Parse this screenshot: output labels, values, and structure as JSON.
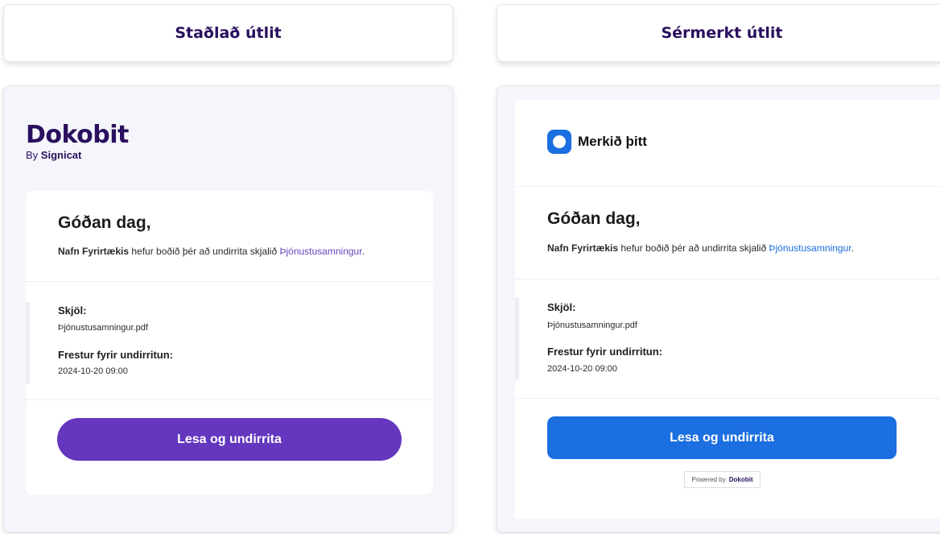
{
  "headers": {
    "standard": "Staðlað útlit",
    "branded": "Sérmerkt útlit"
  },
  "standard_email": {
    "logo": {
      "name": "Dokobit",
      "by": "By",
      "parent": "Signicat"
    },
    "greeting": "Góðan dag,",
    "invite": {
      "company": "Nafn Fyrirtækis",
      "text": " hefur boðið þér að undirrita skjalið ",
      "document_link": "Þjónustusamningur",
      "end": "."
    },
    "documents_label": "Skjöl:",
    "document_file": "Þjónustusamningur.pdf",
    "deadline_label": "Frestur fyrir undirritun:",
    "deadline_value": "2024-10-20 09:00",
    "cta_label": "Lesa og undirrita"
  },
  "branded_email": {
    "brand_name": "Merkið þitt",
    "greeting": "Góðan dag,",
    "invite": {
      "company": "Nafn Fyrirtækis",
      "text": " hefur boðið þér að undirrita skjalið ",
      "document_link": "Þjónustusamningur",
      "end": "."
    },
    "documents_label": "Skjöl:",
    "document_file": "Þjónustusamningur.pdf",
    "deadline_label": "Frestur fyrir undirritun:",
    "deadline_value": "2024-10-20 09:00",
    "cta_label": "Lesa og undirrita",
    "powered_by": "Powered by",
    "powered_brand": "Dokobit"
  },
  "colors": {
    "standard_accent": "#6437BE",
    "branded_accent": "#1B6FE0",
    "heading_dark": "#2A0F5E"
  },
  "icons": {
    "brand_mark": "rounded-square-circle-icon"
  }
}
